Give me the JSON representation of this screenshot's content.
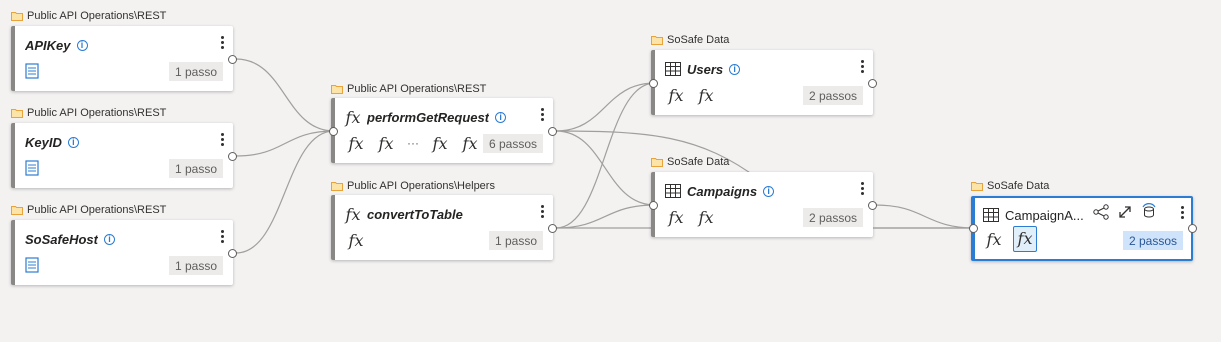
{
  "colors": {
    "folder": "#f2b53d",
    "accent": "#2b7cd3",
    "wire": "#a19f9d"
  },
  "nodes": {
    "apikey": {
      "folder": "Public API Operations\\REST",
      "title": "APIKey",
      "steps": "1 passo",
      "icon": "parameter-icon",
      "info": "i"
    },
    "keyid": {
      "folder": "Public API Operations\\REST",
      "title": "KeyID",
      "steps": "1 passo",
      "icon": "parameter-icon",
      "info": "i"
    },
    "sosafehost": {
      "folder": "Public API Operations\\REST",
      "title": "SoSafeHost",
      "steps": "1 passo",
      "icon": "parameter-icon",
      "info": "i"
    },
    "performgetrequest": {
      "folder": "Public API Operations\\REST",
      "title": "performGetRequest",
      "steps": "6 passos",
      "icon": "function-icon",
      "info": "i",
      "fx": "fx",
      "ellipsis": "···"
    },
    "converttotable": {
      "folder": "Public API Operations\\Helpers",
      "title": "convertToTable",
      "steps": "1 passo",
      "icon": "function-icon",
      "fx": "fx"
    },
    "users": {
      "folder": "SoSafe Data",
      "title": "Users",
      "steps": "2 passos",
      "icon": "table-icon",
      "info": "i",
      "fx": "fx"
    },
    "campaigns": {
      "folder": "SoSafe Data",
      "title": "Campaigns",
      "steps": "2 passos",
      "icon": "table-icon",
      "info": "i",
      "fx": "fx"
    },
    "campaigna": {
      "folder": "SoSafe Data",
      "title": "CampaignA...",
      "steps": "2 passos",
      "icon": "table-icon",
      "fx": "fx"
    }
  }
}
